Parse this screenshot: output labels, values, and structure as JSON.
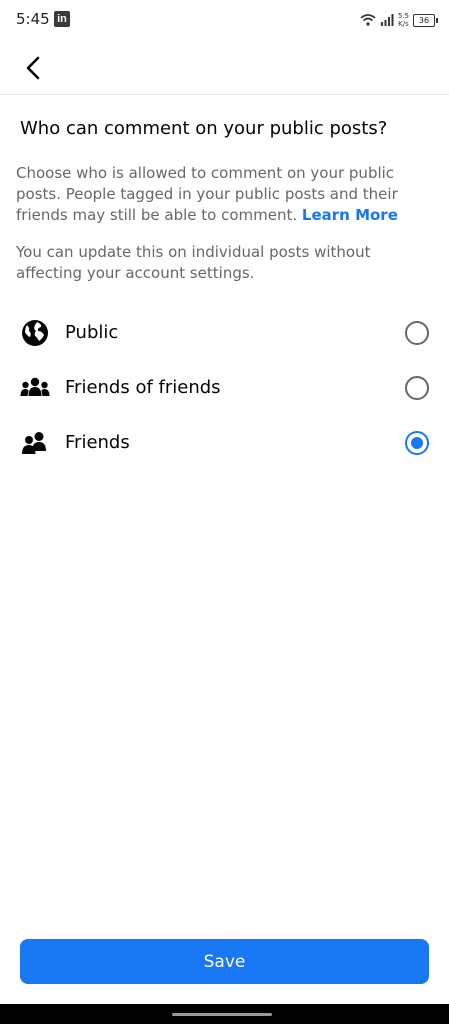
{
  "status_bar": {
    "time": "5:45",
    "app_badge": "in",
    "speed_value": "5.5",
    "speed_unit": "K/s",
    "battery": "36"
  },
  "header": {
    "back_icon": "chevron-left-icon"
  },
  "content": {
    "title": "Who can comment on your public posts?",
    "description": "Choose who is allowed to comment on your public posts. People tagged in your public posts and their friends may still be able to comment.",
    "learn_more": "Learn More",
    "update_note": "You can update this on individual posts without affecting your account settings."
  },
  "options": [
    {
      "label": "Public",
      "icon": "globe-icon",
      "selected": false
    },
    {
      "label": "Friends of friends",
      "icon": "friends-of-friends-icon",
      "selected": false
    },
    {
      "label": "Friends",
      "icon": "friends-icon",
      "selected": true
    }
  ],
  "footer": {
    "save_label": "Save"
  },
  "colors": {
    "accent": "#1877f2",
    "secondary_text": "#65676b",
    "primary_text": "#050505"
  }
}
